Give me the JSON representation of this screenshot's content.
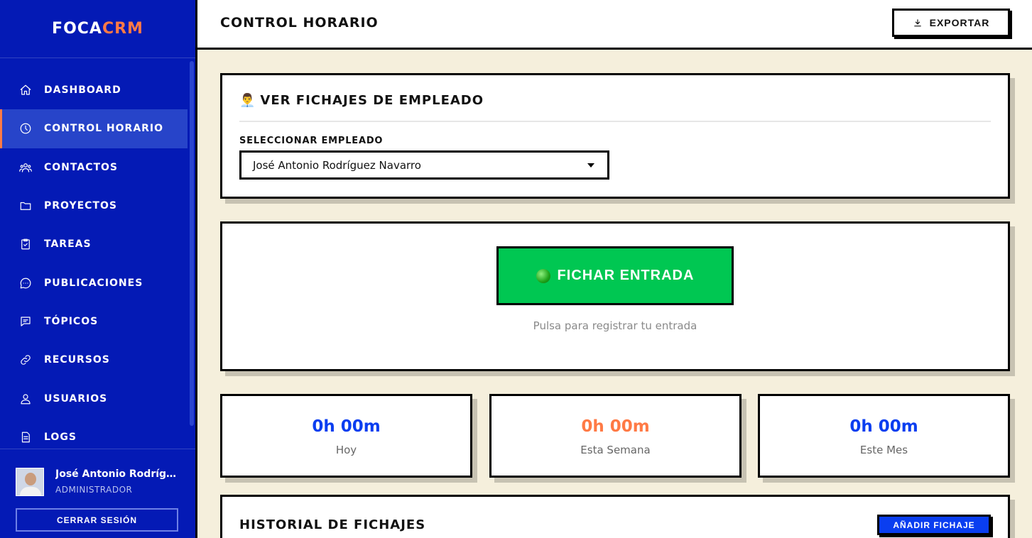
{
  "brand": {
    "part1": "FOCA",
    "part2": "CRM",
    "color1": "#ffffff",
    "color2": "#ff7a45"
  },
  "sidebar": {
    "items": [
      {
        "label": "DASHBOARD",
        "icon": "home-icon",
        "active": false
      },
      {
        "label": "CONTROL HORARIO",
        "icon": "clock-icon",
        "active": true
      },
      {
        "label": "CONTACTOS",
        "icon": "users-group-icon",
        "active": false
      },
      {
        "label": "PROYECTOS",
        "icon": "folder-icon",
        "active": false
      },
      {
        "label": "TAREAS",
        "icon": "clipboard-check-icon",
        "active": false
      },
      {
        "label": "PUBLICACIONES",
        "icon": "chat-bubble-icon",
        "active": false
      },
      {
        "label": "TÓPICOS",
        "icon": "message-square-icon",
        "active": false
      },
      {
        "label": "RECURSOS",
        "icon": "link-icon",
        "active": false
      },
      {
        "label": "USUARIOS",
        "icon": "user-icon",
        "active": false
      },
      {
        "label": "LOGS",
        "icon": "document-icon",
        "active": false
      }
    ]
  },
  "user": {
    "name": "José Antonio Rodrígu...",
    "role": "ADMINISTRADOR",
    "logout_label": "CERRAR SESIÓN"
  },
  "header": {
    "title": "CONTROL HORARIO",
    "export_label": "EXPORTAR"
  },
  "employee_card": {
    "emoji": "👨‍💼",
    "title": "VER FICHAJES DE EMPLEADO",
    "select_label": "SELECCIONAR EMPLEADO",
    "selected": "José Antonio Rodríguez Navarro"
  },
  "checkin": {
    "button_label": "FICHAR ENTRADA",
    "hint": "Pulsa para registrar tu entrada",
    "button_color": "#00c752"
  },
  "stats": [
    {
      "value": "0h 00m",
      "label": "Hoy",
      "color": "#0a3ef0"
    },
    {
      "value": "0h 00m",
      "label": "Esta Semana",
      "color": "#ff7a45"
    },
    {
      "value": "0h 00m",
      "label": "Este Mes",
      "color": "#0a3ef0"
    }
  ],
  "history": {
    "title": "HISTORIAL DE FICHAJES",
    "add_label": "AÑADIR FICHAJE"
  }
}
